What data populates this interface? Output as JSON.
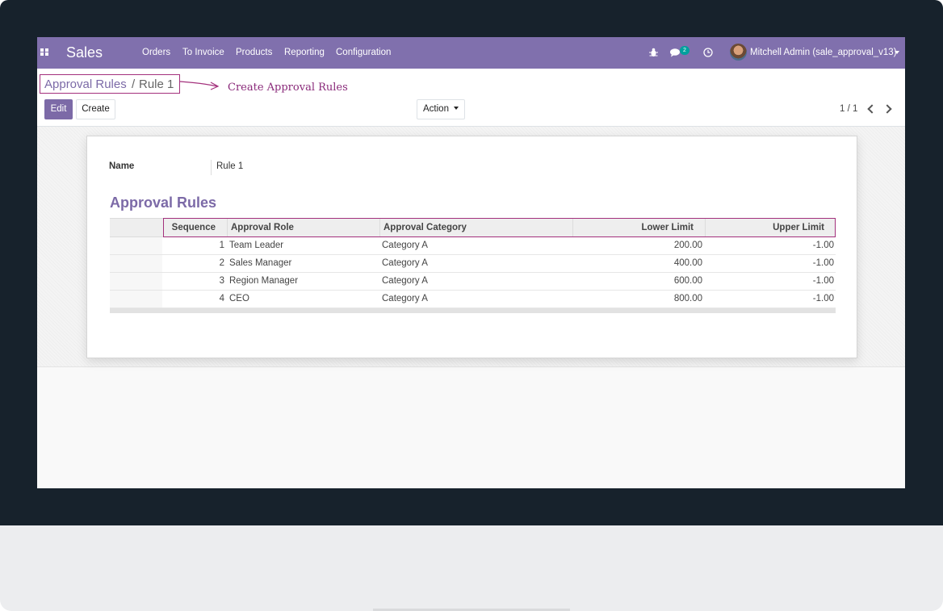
{
  "navbar": {
    "app_name": "Sales",
    "menu": [
      "Orders",
      "To Invoice",
      "Products",
      "Reporting",
      "Configuration"
    ],
    "messages_badge": "2",
    "user_name": "Mitchell Admin (sale_approval_v13)",
    "icons": [
      "apps-grid-icon",
      "bug-icon",
      "chat-icon",
      "clock-icon",
      "user-avatar"
    ],
    "color": "#8070ad"
  },
  "breadcrumb": {
    "parent": "Approval Rules",
    "separator": "/",
    "current": "Rule 1"
  },
  "annotation": {
    "text": "Create Approval Rules",
    "color": "#a3307c"
  },
  "buttons": {
    "edit": "Edit",
    "create": "Create",
    "action": "Action"
  },
  "pager": {
    "value": "1 / 1"
  },
  "form": {
    "name_label": "Name",
    "name_value": "Rule 1",
    "section_title": "Approval Rules",
    "columns": [
      "Sequence",
      "Approval Role",
      "Approval Category",
      "Lower Limit",
      "Upper Limit"
    ],
    "rows": [
      {
        "sequence": "1",
        "role": "Team Leader",
        "category": "Category A",
        "lower": "200.00",
        "upper": "-1.00"
      },
      {
        "sequence": "2",
        "role": "Sales Manager",
        "category": "Category A",
        "lower": "400.00",
        "upper": "-1.00"
      },
      {
        "sequence": "3",
        "role": "Region Manager",
        "category": "Category A",
        "lower": "600.00",
        "upper": "-1.00"
      },
      {
        "sequence": "4",
        "role": "CEO",
        "category": "Category A",
        "lower": "800.00",
        "upper": "-1.00"
      }
    ]
  },
  "colors": {
    "accent": "#7c6aa7",
    "highlight_box": "#a3307c",
    "badge": "#00a09d"
  }
}
